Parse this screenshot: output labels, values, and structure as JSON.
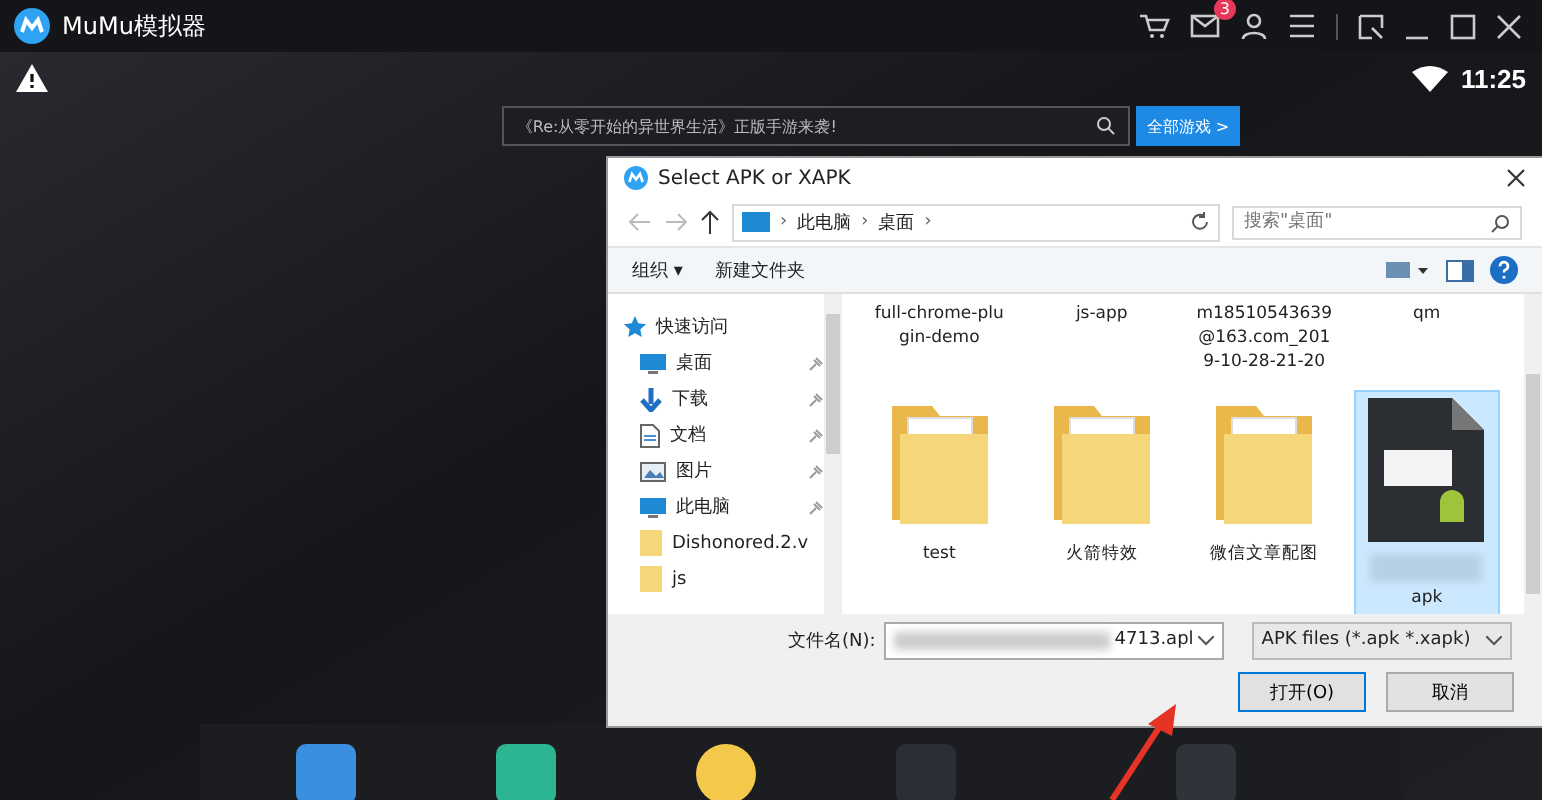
{
  "app": {
    "title": "MuMu模拟器",
    "mail_badge": "3"
  },
  "status": {
    "time": "11:25"
  },
  "search": {
    "value": "《Re:从零开始的异世界生活》正版手游来袭!",
    "button": "全部游戏 >"
  },
  "dialog": {
    "title": "Select APK or XAPK",
    "path": [
      "此电脑",
      "桌面"
    ],
    "path_separator": "›",
    "search_placeholder": "搜索\"桌面\"",
    "toolbar": {
      "organize": "组织 ▾",
      "new_folder": "新建文件夹"
    },
    "sidebar": [
      {
        "label": "快速访问",
        "kind": "star",
        "pinned": false
      },
      {
        "label": "桌面",
        "kind": "desktop",
        "pinned": true
      },
      {
        "label": "下载",
        "kind": "download",
        "pinned": true
      },
      {
        "label": "文档",
        "kind": "doc",
        "pinned": true
      },
      {
        "label": "图片",
        "kind": "picture",
        "pinned": true
      },
      {
        "label": "此电脑",
        "kind": "desktop",
        "pinned": true
      },
      {
        "label": "Dishonored.2.v",
        "kind": "folder",
        "pinned": false
      },
      {
        "label": "js",
        "kind": "folder",
        "pinned": false
      }
    ],
    "top_files": [
      {
        "label": "full-chrome-plu\ngin-demo"
      },
      {
        "label": "js-app"
      },
      {
        "label": "m18510543639\n@163.com_201\n9-10-28-21-20"
      },
      {
        "label": "qm"
      }
    ],
    "files": [
      {
        "label": "test",
        "kind": "folder",
        "selected": false
      },
      {
        "label": "火箭特效",
        "kind": "folder",
        "selected": false
      },
      {
        "label": "微信文章配图",
        "kind": "folder",
        "selected": false
      },
      {
        "label": "apk",
        "kind": "apk",
        "selected": true
      }
    ],
    "filename_label": "文件名(N):",
    "filename": "4713.apl",
    "filetype": "APK files (*.apk *.xapk)",
    "open_button": "打开(O)",
    "cancel_button": "取消"
  }
}
